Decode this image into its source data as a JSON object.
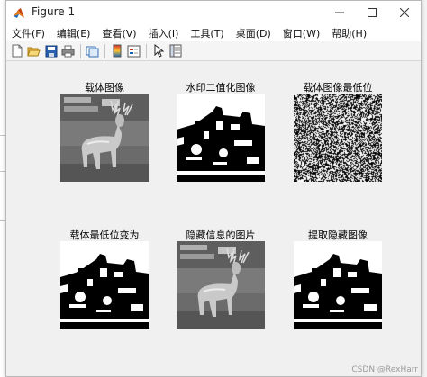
{
  "window": {
    "title": "Figure 1",
    "minimize_icon": "minimize-icon",
    "maximize_icon": "maximize-icon",
    "close_icon": "close-icon"
  },
  "menubar": {
    "items": [
      "文件(F)",
      "编辑(E)",
      "查看(V)",
      "插入(I)",
      "工具(T)",
      "桌面(D)",
      "窗口(W)",
      "帮助(H)"
    ]
  },
  "toolbar": {
    "icons": [
      "new-figure-icon",
      "open-file-icon",
      "save-figure-icon",
      "print-figure-icon",
      "link-plot-icon",
      "insert-colorbar-icon",
      "insert-legend-icon",
      "edit-plot-icon",
      "property-inspector-icon"
    ]
  },
  "figure": {
    "subplots": [
      {
        "title": "载体图像",
        "image": "deer-grayscale"
      },
      {
        "title": "水印二值化图像",
        "image": "train-binary"
      },
      {
        "title": "载体图像最低位",
        "image": "random-noise"
      },
      {
        "title": "载体最低位变为",
        "image": "train-binary"
      },
      {
        "title": "隐藏信息的图片",
        "image": "deer-grayscale"
      },
      {
        "title": "提取隐藏图像",
        "image": "train-binary"
      }
    ]
  },
  "background": {
    "editor_chars": [
      ",r",
      "d",
      "Cr",
      "e",
      "o"
    ]
  },
  "watermark": "CSDN @RexHarr"
}
